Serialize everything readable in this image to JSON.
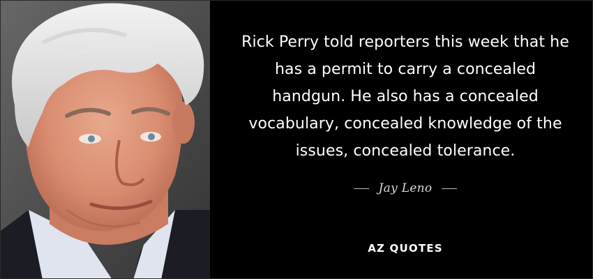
{
  "quote": {
    "text": "Rick Perry told reporters this week that he has a permit to carry a concealed handgun. He also has a concealed vocabulary, concealed knowledge of the issues, concealed tolerance.",
    "author": "Jay Leno"
  },
  "brand": {
    "logo_text": "AZ QUOTES"
  },
  "colors": {
    "background": "#000000",
    "text": "#ffffff"
  }
}
